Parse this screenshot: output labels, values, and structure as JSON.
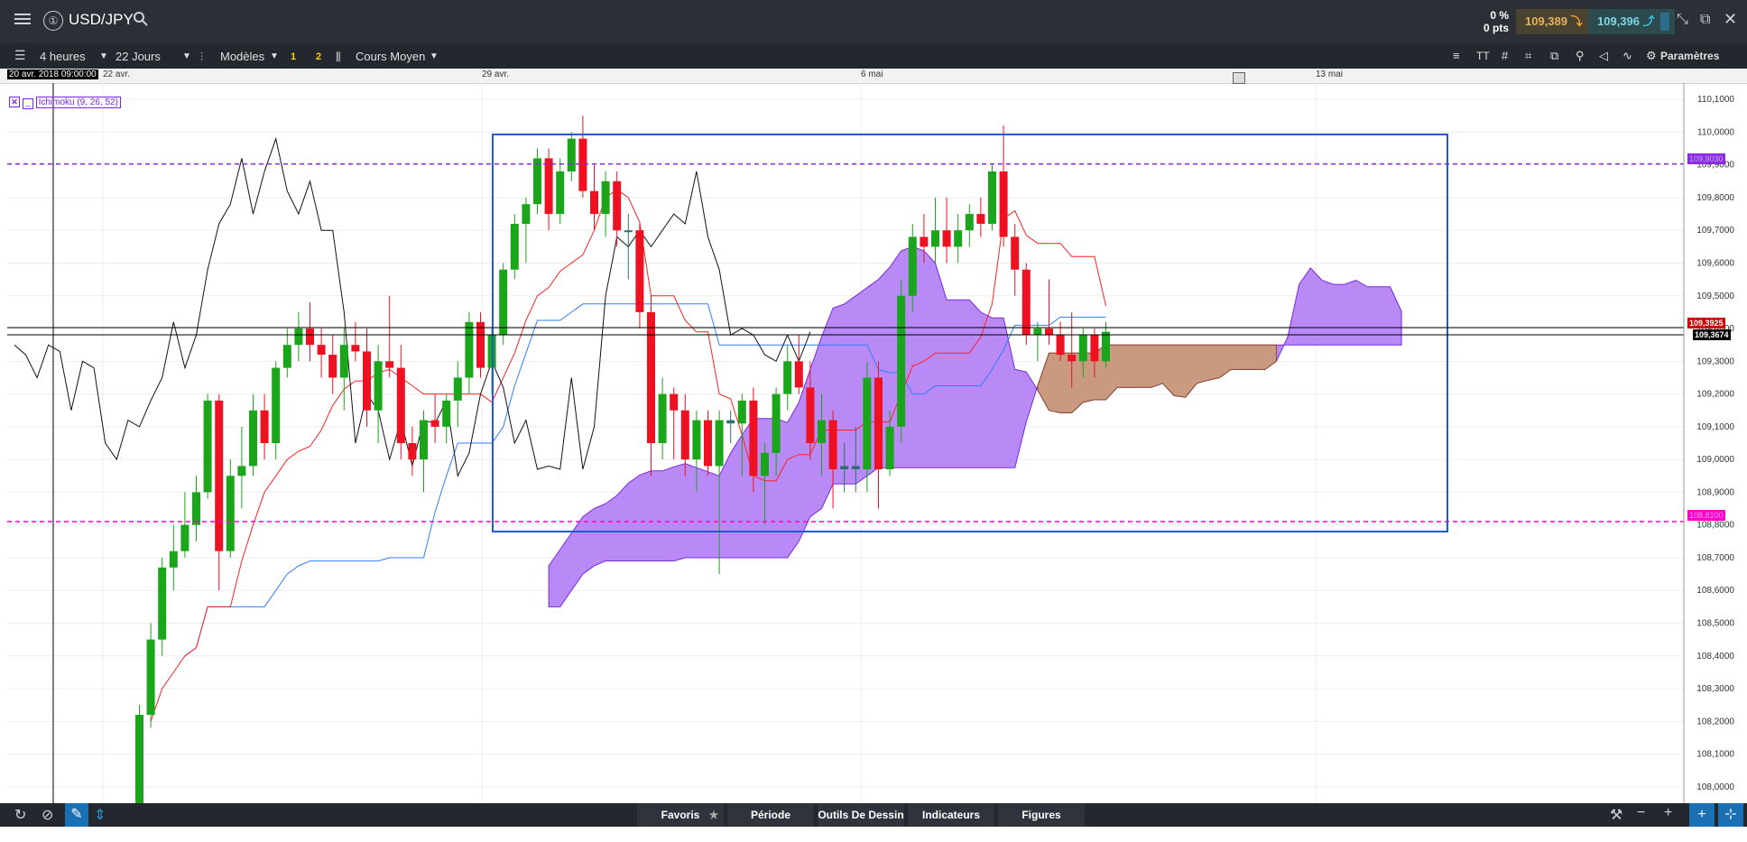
{
  "toolbar": {
    "symbol": "USD/JPY",
    "percent_label": "0 %",
    "pts_label": "0 pts",
    "bid": "109,389",
    "ask": "109,396",
    "timeframe": "4 heures",
    "range": "22 Jours",
    "models": "Modèles",
    "layout1": "1",
    "layout2": "2",
    "price_type": "Cours Moyen",
    "settings": "Paramètres"
  },
  "date_axis": {
    "cursor_date": "20 avr. 2018 09:00:00",
    "ticks": [
      "22 avr.",
      "29 avr.",
      "6 mai",
      "13 mai"
    ]
  },
  "indicator": {
    "label": "Ichimoku (9, 26, 52)"
  },
  "bottom": {
    "favorites": "Favoris",
    "period": "Période",
    "drawing_tools": "Outils De Dessin",
    "indicators": "Indicateurs",
    "figures": "Figures"
  },
  "chart_data": {
    "type": "candlestick",
    "title": "USD/JPY",
    "ylim": [
      107.95,
      110.15
    ],
    "yticks": [
      "110,1000",
      "110,0000",
      "109,9000",
      "109,8000",
      "109,7000",
      "109,6000",
      "109,5000",
      "109,4000",
      "109,3000",
      "109,2000",
      "109,1000",
      "109,0000",
      "108,9000",
      "108,8000",
      "108,7000",
      "108,6000",
      "108,5000",
      "108,4000",
      "108,3000",
      "108,2000",
      "108,1000",
      "108,0000"
    ],
    "horizontal_lines": [
      {
        "label": "109,9030",
        "value": 109.903,
        "color": "#8a2be2"
      },
      {
        "label": "108,8100",
        "value": 108.81,
        "color": "#ff00cc"
      }
    ],
    "price_labels": [
      {
        "label": "109,3925",
        "value": 109.3925,
        "color": "#cc0000"
      },
      {
        "label": "109,3674",
        "value": 109.3674,
        "color": "#000000"
      }
    ],
    "candles": [
      {
        "o": 107.9,
        "h": 108.25,
        "l": 107.9,
        "c": 108.22
      },
      {
        "o": 108.22,
        "h": 108.5,
        "l": 108.18,
        "c": 108.45
      },
      {
        "o": 108.45,
        "h": 108.7,
        "l": 108.4,
        "c": 108.67
      },
      {
        "o": 108.67,
        "h": 108.8,
        "l": 108.6,
        "c": 108.72
      },
      {
        "o": 108.72,
        "h": 108.9,
        "l": 108.7,
        "c": 108.8
      },
      {
        "o": 108.8,
        "h": 108.95,
        "l": 108.75,
        "c": 108.9
      },
      {
        "o": 108.9,
        "h": 109.2,
        "l": 108.88,
        "c": 109.18
      },
      {
        "o": 109.18,
        "h": 109.2,
        "l": 108.6,
        "c": 108.72
      },
      {
        "o": 108.72,
        "h": 109.0,
        "l": 108.7,
        "c": 108.95
      },
      {
        "o": 108.95,
        "h": 109.1,
        "l": 108.85,
        "c": 108.98
      },
      {
        "o": 108.98,
        "h": 109.2,
        "l": 108.95,
        "c": 109.15
      },
      {
        "o": 109.15,
        "h": 109.2,
        "l": 109.0,
        "c": 109.05
      },
      {
        "o": 109.05,
        "h": 109.3,
        "l": 109.0,
        "c": 109.28
      },
      {
        "o": 109.28,
        "h": 109.4,
        "l": 109.25,
        "c": 109.35
      },
      {
        "o": 109.35,
        "h": 109.45,
        "l": 109.3,
        "c": 109.4
      },
      {
        "o": 109.4,
        "h": 109.48,
        "l": 109.3,
        "c": 109.35
      },
      {
        "o": 109.35,
        "h": 109.4,
        "l": 109.25,
        "c": 109.32
      },
      {
        "o": 109.32,
        "h": 109.38,
        "l": 109.2,
        "c": 109.25
      },
      {
        "o": 109.25,
        "h": 109.4,
        "l": 109.15,
        "c": 109.35
      },
      {
        "o": 109.35,
        "h": 109.42,
        "l": 109.3,
        "c": 109.33
      },
      {
        "o": 109.33,
        "h": 109.4,
        "l": 109.1,
        "c": 109.15
      },
      {
        "o": 109.15,
        "h": 109.35,
        "l": 109.05,
        "c": 109.3
      },
      {
        "o": 109.3,
        "h": 109.5,
        "l": 109.25,
        "c": 109.28
      },
      {
        "o": 109.28,
        "h": 109.35,
        "l": 109.0,
        "c": 109.05
      },
      {
        "o": 109.05,
        "h": 109.1,
        "l": 108.95,
        "c": 109.0
      },
      {
        "o": 109.0,
        "h": 109.15,
        "l": 108.9,
        "c": 109.12
      },
      {
        "o": 109.12,
        "h": 109.2,
        "l": 109.05,
        "c": 109.1
      },
      {
        "o": 109.1,
        "h": 109.2,
        "l": 109.05,
        "c": 109.18
      },
      {
        "o": 109.18,
        "h": 109.3,
        "l": 109.1,
        "c": 109.25
      },
      {
        "o": 109.25,
        "h": 109.45,
        "l": 109.2,
        "c": 109.42
      },
      {
        "o": 109.42,
        "h": 109.45,
        "l": 109.25,
        "c": 109.28
      },
      {
        "o": 109.28,
        "h": 109.4,
        "l": 109.2,
        "c": 109.38
      },
      {
        "o": 109.38,
        "h": 109.6,
        "l": 109.35,
        "c": 109.58
      },
      {
        "o": 109.58,
        "h": 109.75,
        "l": 109.55,
        "c": 109.72
      },
      {
        "o": 109.72,
        "h": 109.8,
        "l": 109.6,
        "c": 109.78
      },
      {
        "o": 109.78,
        "h": 109.95,
        "l": 109.75,
        "c": 109.92
      },
      {
        "o": 109.92,
        "h": 109.95,
        "l": 109.7,
        "c": 109.75
      },
      {
        "o": 109.75,
        "h": 109.92,
        "l": 109.72,
        "c": 109.88
      },
      {
        "o": 109.88,
        "h": 110.0,
        "l": 109.85,
        "c": 109.98
      },
      {
        "o": 109.98,
        "h": 110.05,
        "l": 109.8,
        "c": 109.82
      },
      {
        "o": 109.82,
        "h": 109.9,
        "l": 109.7,
        "c": 109.75
      },
      {
        "o": 109.75,
        "h": 109.88,
        "l": 109.68,
        "c": 109.85
      },
      {
        "o": 109.85,
        "h": 109.88,
        "l": 109.65,
        "c": 109.7
      },
      {
        "o": 109.7,
        "h": 109.75,
        "l": 109.55,
        "c": 109.7
      },
      {
        "o": 109.7,
        "h": 109.72,
        "l": 109.4,
        "c": 109.45
      },
      {
        "o": 109.45,
        "h": 109.5,
        "l": 108.95,
        "c": 109.05
      },
      {
        "o": 109.05,
        "h": 109.25,
        "l": 109.0,
        "c": 109.2
      },
      {
        "o": 109.2,
        "h": 109.22,
        "l": 109.0,
        "c": 109.15
      },
      {
        "o": 109.15,
        "h": 109.2,
        "l": 108.95,
        "c": 109.0
      },
      {
        "o": 109.0,
        "h": 109.15,
        "l": 108.9,
        "c": 109.12
      },
      {
        "o": 109.12,
        "h": 109.15,
        "l": 108.95,
        "c": 108.98
      },
      {
        "o": 108.98,
        "h": 109.15,
        "l": 108.65,
        "c": 109.12
      },
      {
        "o": 109.12,
        "h": 109.15,
        "l": 109.05,
        "c": 109.11
      },
      {
        "o": 109.11,
        "h": 109.2,
        "l": 108.95,
        "c": 109.18
      },
      {
        "o": 109.18,
        "h": 109.22,
        "l": 108.9,
        "c": 108.95
      },
      {
        "o": 108.95,
        "h": 109.05,
        "l": 108.8,
        "c": 109.02
      },
      {
        "o": 109.02,
        "h": 109.22,
        "l": 108.95,
        "c": 109.2
      },
      {
        "o": 109.2,
        "h": 109.35,
        "l": 109.15,
        "c": 109.3
      },
      {
        "o": 109.3,
        "h": 109.38,
        "l": 109.2,
        "c": 109.22
      },
      {
        "o": 109.22,
        "h": 109.3,
        "l": 109.0,
        "c": 109.05
      },
      {
        "o": 109.05,
        "h": 109.2,
        "l": 108.95,
        "c": 109.12
      },
      {
        "o": 109.12,
        "h": 109.15,
        "l": 108.85,
        "c": 108.97
      },
      {
        "o": 108.97,
        "h": 109.05,
        "l": 108.9,
        "c": 108.98
      },
      {
        "o": 108.98,
        "h": 109.1,
        "l": 108.9,
        "c": 108.97
      },
      {
        "o": 108.97,
        "h": 109.3,
        "l": 108.9,
        "c": 109.25
      },
      {
        "o": 109.25,
        "h": 109.3,
        "l": 108.85,
        "c": 108.97
      },
      {
        "o": 108.97,
        "h": 109.15,
        "l": 108.95,
        "c": 109.1
      },
      {
        "o": 109.1,
        "h": 109.55,
        "l": 109.05,
        "c": 109.5
      },
      {
        "o": 109.5,
        "h": 109.72,
        "l": 109.45,
        "c": 109.68
      },
      {
        "o": 109.68,
        "h": 109.75,
        "l": 109.6,
        "c": 109.65
      },
      {
        "o": 109.65,
        "h": 109.8,
        "l": 109.6,
        "c": 109.7
      },
      {
        "o": 109.7,
        "h": 109.8,
        "l": 109.6,
        "c": 109.65
      },
      {
        "o": 109.65,
        "h": 109.75,
        "l": 109.6,
        "c": 109.7
      },
      {
        "o": 109.7,
        "h": 109.78,
        "l": 109.65,
        "c": 109.75
      },
      {
        "o": 109.75,
        "h": 109.8,
        "l": 109.68,
        "c": 109.72
      },
      {
        "o": 109.72,
        "h": 109.9,
        "l": 109.7,
        "c": 109.88
      },
      {
        "o": 109.88,
        "h": 110.02,
        "l": 109.65,
        "c": 109.68
      },
      {
        "o": 109.68,
        "h": 109.72,
        "l": 109.5,
        "c": 109.58
      },
      {
        "o": 109.58,
        "h": 109.6,
        "l": 109.35,
        "c": 109.38
      },
      {
        "o": 109.38,
        "h": 109.42,
        "l": 109.3,
        "c": 109.4
      },
      {
        "o": 109.4,
        "h": 109.55,
        "l": 109.35,
        "c": 109.38
      },
      {
        "o": 109.38,
        "h": 109.42,
        "l": 109.3,
        "c": 109.32
      },
      {
        "o": 109.32,
        "h": 109.45,
        "l": 109.22,
        "c": 109.3
      },
      {
        "o": 109.3,
        "h": 109.4,
        "l": 109.25,
        "c": 109.38
      },
      {
        "o": 109.38,
        "h": 109.4,
        "l": 109.25,
        "c": 109.3
      },
      {
        "o": 109.3,
        "h": 109.42,
        "l": 109.28,
        "c": 109.39
      }
    ]
  },
  "colors": {
    "bull": "#1aa51a",
    "bear": "#ee1122",
    "doji": "#2f6f6f",
    "cloud_bull": "#b27cf5",
    "cloud_bear": "#c9977d",
    "tenkan": "#ff2020",
    "kijun": "#2f7fff",
    "chikou": "#111111",
    "box": "#1f5bd6"
  }
}
